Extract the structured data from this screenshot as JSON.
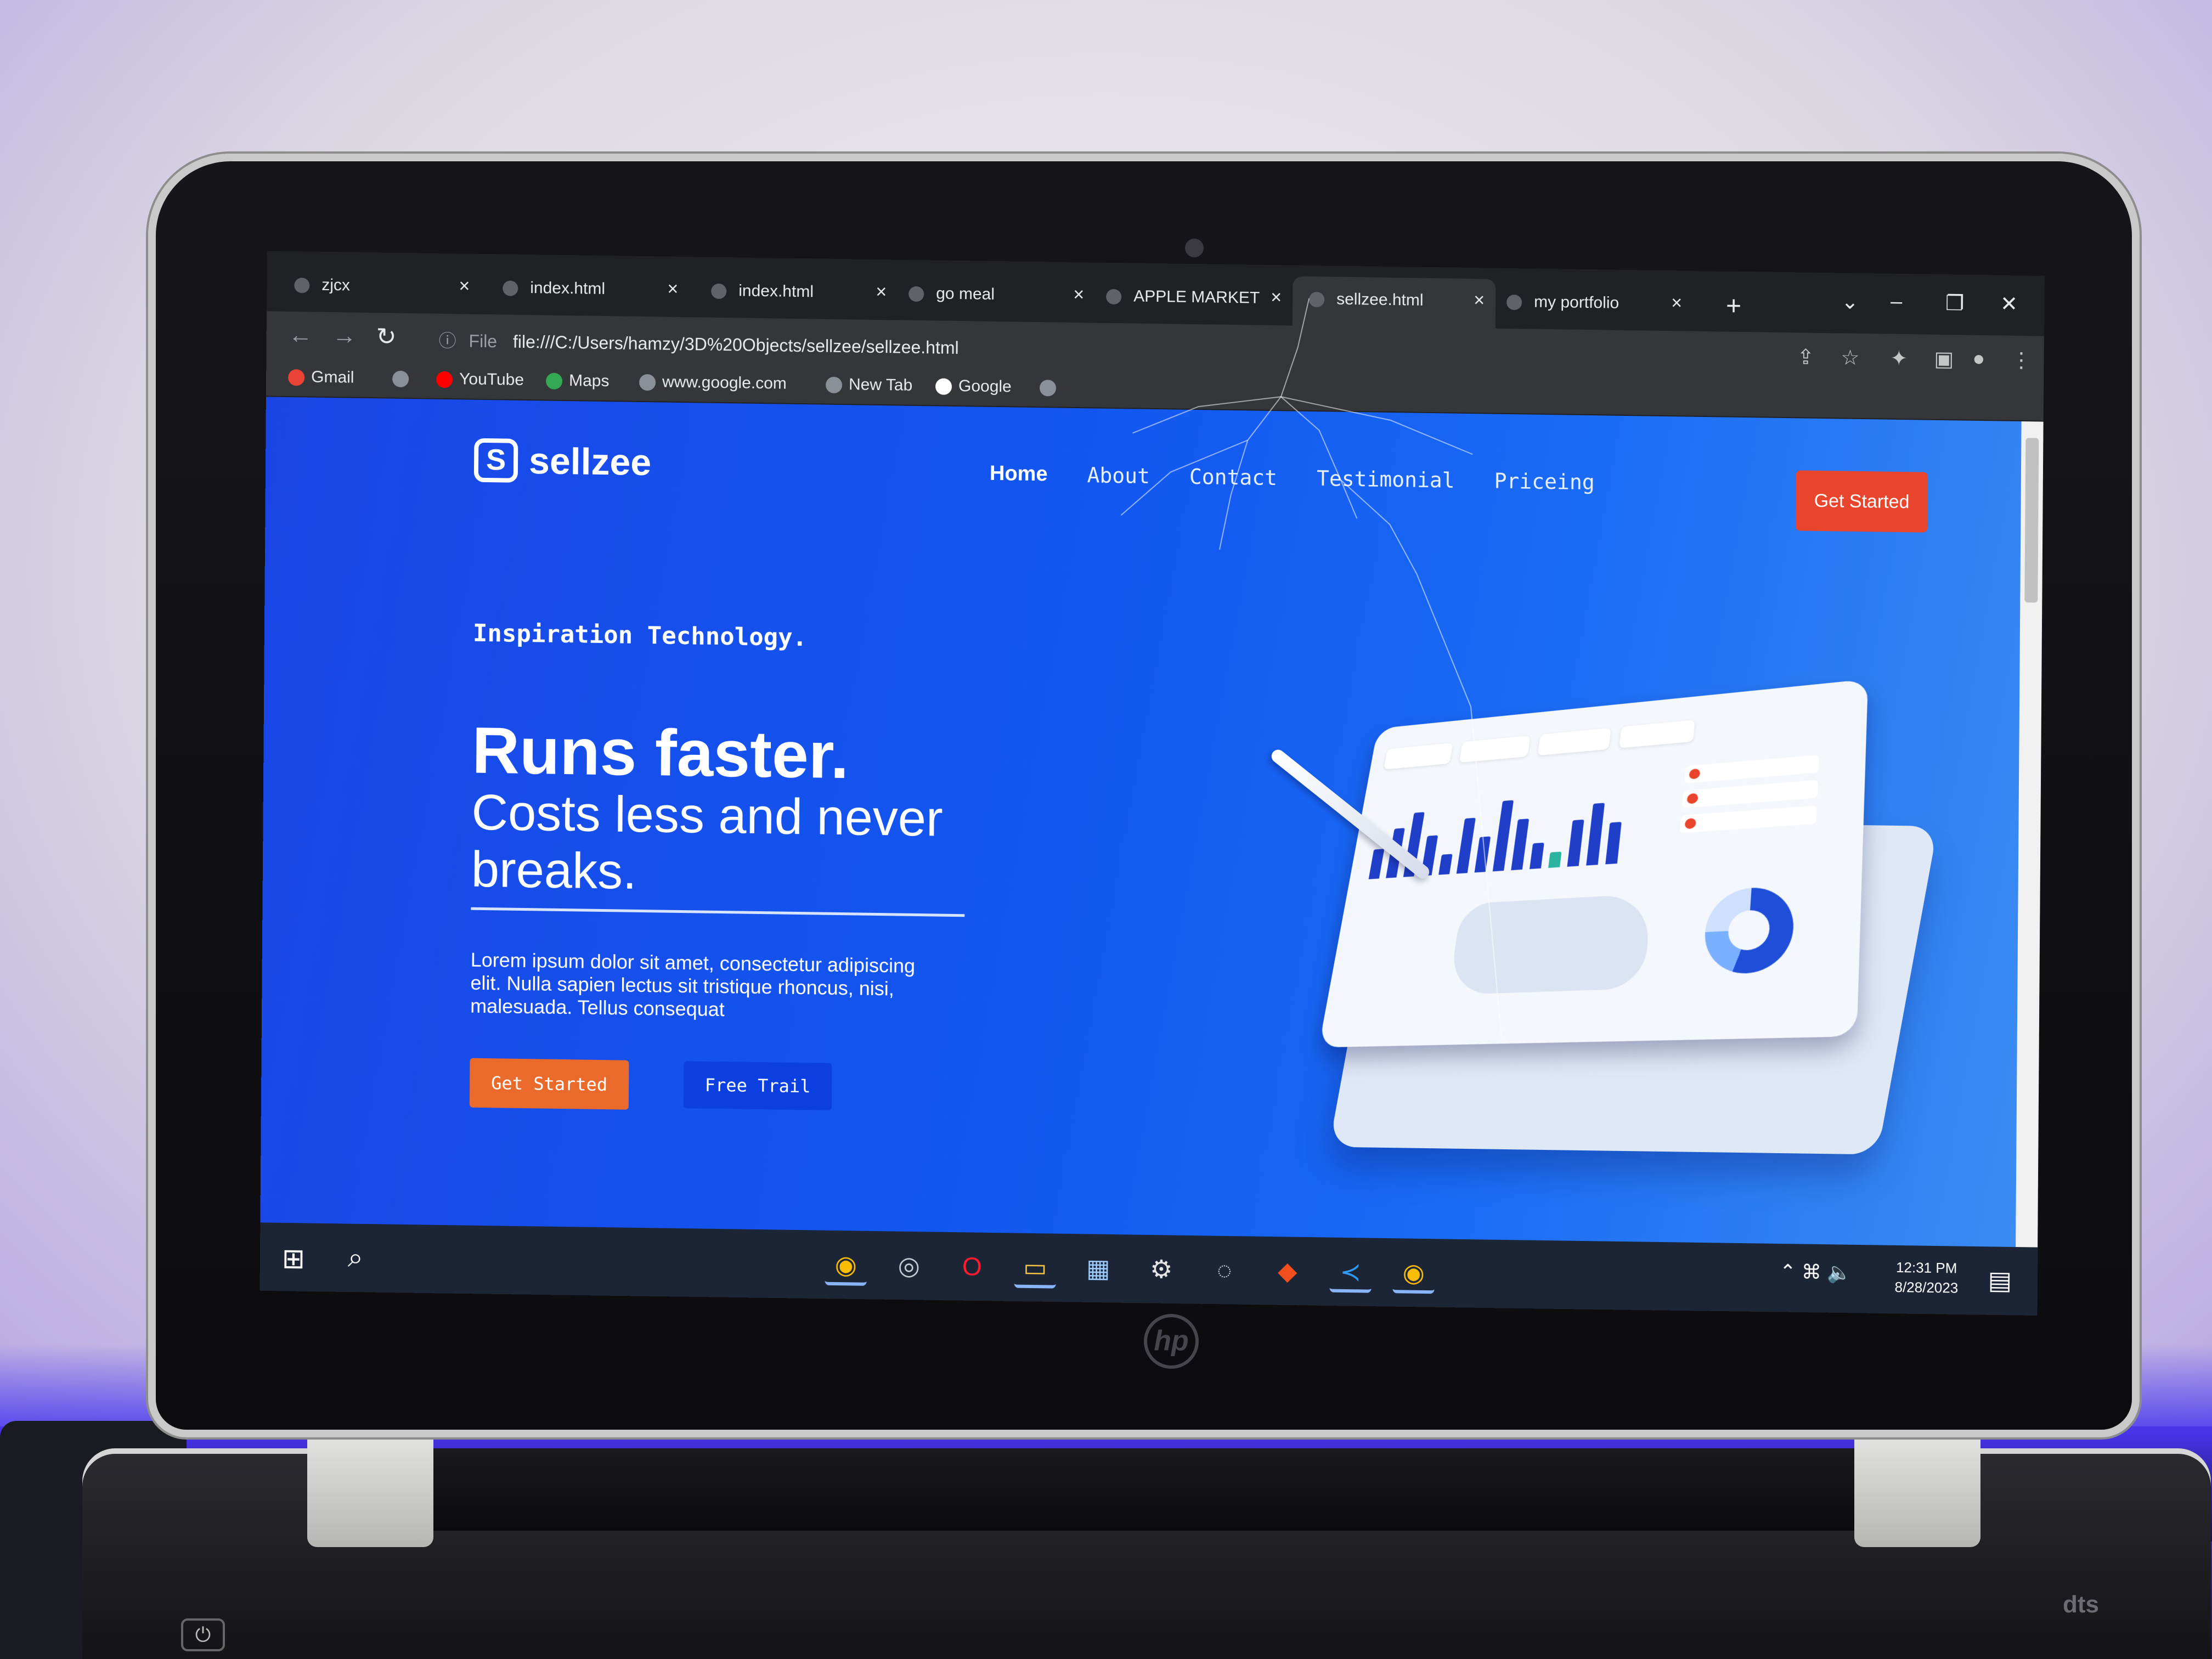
{
  "browser": {
    "tabs": [
      {
        "label": "zjcx"
      },
      {
        "label": "index.html"
      },
      {
        "label": "index.html"
      },
      {
        "label": "go meal"
      },
      {
        "label": "APPLE MARKET"
      },
      {
        "label": "sellzee.html",
        "active": true
      },
      {
        "label": "my portfolio"
      }
    ],
    "close_glyph": "×",
    "new_tab_glyph": "+",
    "address": {
      "info_glyph": "ⓘ",
      "scheme_label": "File",
      "url": "file:///C:/Users/hamzy/3D%20Objects/sellzee/sellzee.html"
    },
    "bookmarks": [
      {
        "label": "Gmail",
        "color": "#ea4335"
      },
      {
        "label": "",
        "color": "#8a8f98"
      },
      {
        "label": "YouTube",
        "color": "#ff0000"
      },
      {
        "label": "Maps",
        "color": "#34a853"
      },
      {
        "label": "www.google.com",
        "color": "#8a8f98"
      },
      {
        "label": "New Tab",
        "color": "#8a8f98"
      },
      {
        "label": "Google",
        "color": "#ffffff"
      },
      {
        "label": "",
        "color": "#8a8f98"
      }
    ]
  },
  "site": {
    "logo_mark": "S",
    "logo_text": "sellzee",
    "nav": [
      "Home",
      "About",
      "Contact",
      "Testimonial",
      "Priceing"
    ],
    "nav_cta": "Get Started",
    "eyebrow": "Inspiration Technology.",
    "headline": "Runs faster.",
    "subhead": "Costs less and never breaks.",
    "body": "Lorem ipsum dolor sit amet, consectetur adipiscing elit. Nulla sapien lectus sit tristique rhoncus, nisi, malesuada. Tellus consequat",
    "primary_button": "Get Started",
    "secondary_button": "Free Trail",
    "colors": {
      "page_blue": "#1257f0",
      "cta_red": "#e8452c",
      "cta_orange": "#ea6a2c",
      "secondary_blue": "#0b3fe0"
    }
  },
  "taskbar": {
    "clock_time": "12:31 PM",
    "clock_date": "8/28/2023",
    "apps": [
      "chrome-icon",
      "obs-icon",
      "opera-icon",
      "file-explorer-icon",
      "store-icon",
      "settings-icon",
      "browser-icon",
      "figma-icon",
      "vscode-icon",
      "chrome-icon"
    ]
  },
  "laptop": {
    "brand": "hp",
    "speaker_badge": "dts"
  }
}
